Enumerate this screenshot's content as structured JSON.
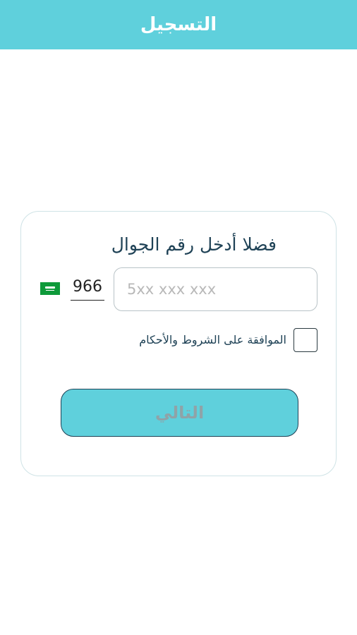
{
  "header": {
    "title": "التسجيل"
  },
  "card": {
    "title": "فضلا أدخل رقم الجوال",
    "phone": {
      "placeholder": "5xx xxx xxx",
      "value": "",
      "country_code": "966",
      "flag_icon": "saudi-arabia-flag-icon"
    },
    "terms": {
      "label": "الموافقة على الشروط والأحكام",
      "checked": false
    },
    "next_button_label": "التالي"
  },
  "colors": {
    "accent": "#5fd0dc",
    "text_dark": "#1f4256",
    "button_text_disabled": "#8fa3a8",
    "flag_green": "#0e9a3a"
  }
}
